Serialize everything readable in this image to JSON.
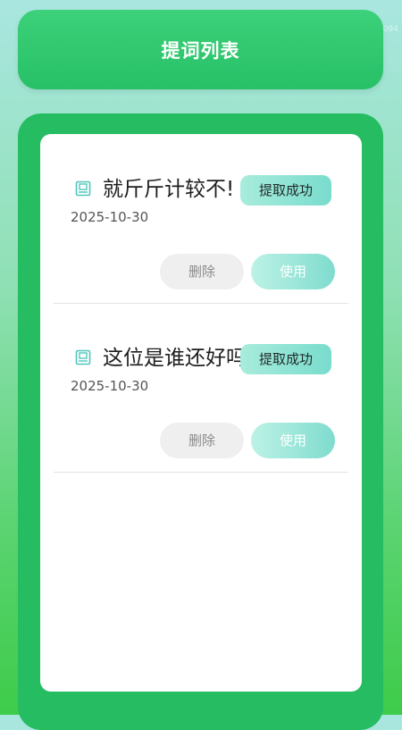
{
  "header": {
    "title": "提词列表"
  },
  "watermark": "...1094",
  "items": [
    {
      "icon": "book-icon",
      "title": "就斤斤计较不!",
      "status": "提取成功",
      "date": "2025-10-30",
      "delete_label": "删除",
      "use_label": "使用"
    },
    {
      "icon": "book-icon",
      "title": "这位是谁还好吗",
      "status": "提取成功",
      "date": "2025-10-30",
      "delete_label": "删除",
      "use_label": "使用"
    }
  ],
  "colors": {
    "header": "#2fc76f",
    "panel": "#26bc62",
    "badge": "#8fe3d3",
    "icon": "#4fc7bd"
  }
}
